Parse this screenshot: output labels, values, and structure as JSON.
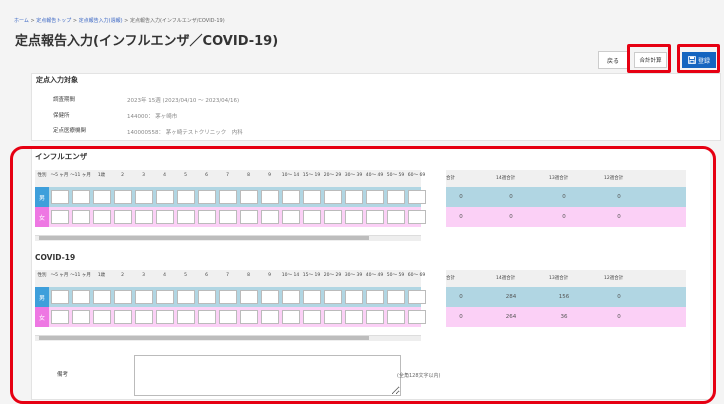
{
  "breadcrumb": {
    "items": [
      "ホーム",
      "定点報告トップ",
      "定点報告入力(週報)",
      "定点報告入力(インフルエンザ/COVID-19)"
    ],
    "separator": ">"
  },
  "page_title": "定点報告入力(インフルエンザ／COVID-19)",
  "toolbar": {
    "back_label": "戻る",
    "calc_label": "合計計算",
    "register_label": "登録",
    "register_icon": "save-icon",
    "highlight_color": "#e60012",
    "register_color": "#1565c0"
  },
  "target": {
    "title": "定点入力対象",
    "rows": [
      {
        "label": "調査期間",
        "value": "2023年 15週 (2023/04/10 ～ 2023/04/16)"
      },
      {
        "label": "保健所",
        "value": "144000： 茅ヶ崎市"
      },
      {
        "label": "定点医療機関",
        "value": "140000558： 茅ヶ崎テストクリニック　内科"
      }
    ]
  },
  "age_headers": [
    "性別",
    "～5 ヶ月",
    "～11 ヶ月",
    "1歳",
    "2",
    "3",
    "4",
    "5",
    "6",
    "7",
    "8",
    "9",
    "10～ 14",
    "15～ 19",
    "20～ 29",
    "30～ 39",
    "40～ 49",
    "50～ 59",
    "60～ 69"
  ],
  "sum_headers": [
    "合計",
    "14週合計",
    "13週合計",
    "12週合計"
  ],
  "sections": [
    {
      "title": "インフルエンザ",
      "rows": [
        {
          "sex": "男",
          "sums": [
            "0",
            "0",
            "0",
            "0"
          ]
        },
        {
          "sex": "女",
          "sums": [
            "0",
            "0",
            "0",
            "0"
          ]
        }
      ]
    },
    {
      "title": "COVID-19",
      "rows": [
        {
          "sex": "男",
          "sums": [
            "0",
            "284",
            "156",
            "0"
          ]
        },
        {
          "sex": "女",
          "sums": [
            "0",
            "264",
            "36",
            "0"
          ]
        }
      ]
    }
  ],
  "remarks": {
    "label": "備考",
    "value": "",
    "note": "(全角128文字以内)"
  },
  "colors": {
    "male_row": "#b1d6e3",
    "female_row": "#fbd0f6",
    "male_sex": "#3e9fdb",
    "female_sex": "#ee77e3"
  }
}
